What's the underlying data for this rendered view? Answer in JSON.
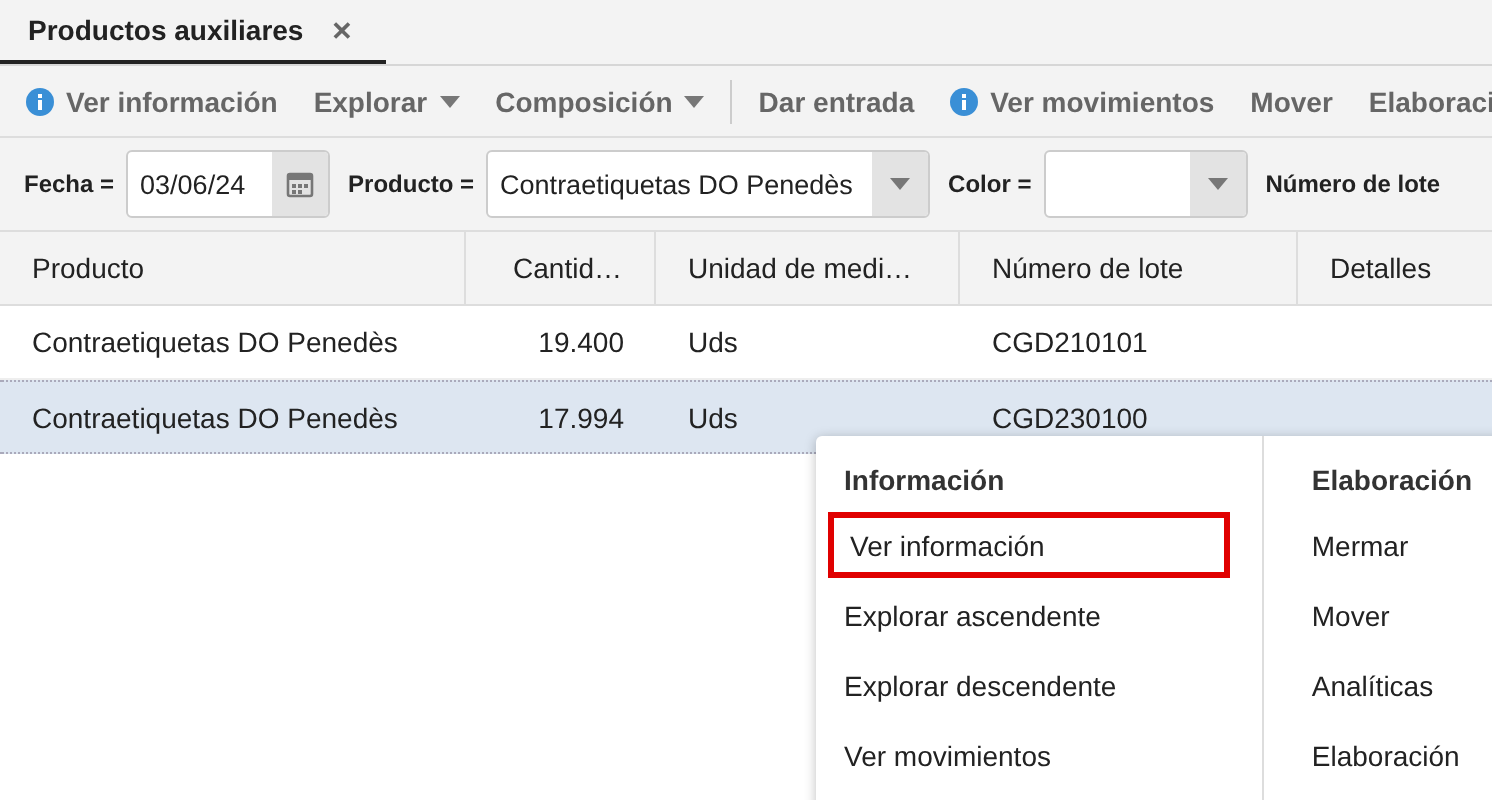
{
  "tabs": [
    {
      "label": "Productos auxiliares",
      "selected": true,
      "close": "✕"
    }
  ],
  "toolbar": [
    {
      "kind": "info",
      "label": "Ver información"
    },
    {
      "kind": "dropdown",
      "label": "Explorar"
    },
    {
      "kind": "dropdown",
      "label": "Composición"
    },
    {
      "kind": "separator"
    },
    {
      "kind": "plain",
      "label": "Dar entrada"
    },
    {
      "kind": "info",
      "label": "Ver movimientos"
    },
    {
      "kind": "plain",
      "label": "Mover"
    },
    {
      "kind": "plain",
      "label": "Elaboraci"
    }
  ],
  "filters": [
    {
      "kind": "date",
      "label": "Fecha =",
      "value": "03/06/24"
    },
    {
      "kind": "select",
      "label": "Producto =",
      "value": "Contraetiquetas DO Penedès"
    },
    {
      "kind": "select",
      "label": "Color ="
    },
    {
      "kind": "label",
      "label": "Número de lote"
    }
  ],
  "table": {
    "columns": [
      {
        "label": "Producto"
      },
      {
        "label": "Cantid…"
      },
      {
        "label": "Unidad de medi…"
      },
      {
        "label": "Número de lote"
      },
      {
        "label": "Detalles"
      }
    ],
    "rows": [
      {
        "selected": false,
        "cells": [
          "Contraetiquetas DO Penedès",
          "19.400",
          "Uds",
          "CGD210101",
          ""
        ]
      },
      {
        "selected": true,
        "cells": [
          "Contraetiquetas DO Penedès",
          "17.994",
          "Uds",
          "CGD230100",
          ""
        ]
      }
    ]
  },
  "context_menu": {
    "sections": [
      {
        "title": "Información",
        "items": [
          {
            "label": "Ver información",
            "highlighted": true
          },
          {
            "label": "Explorar ascendente",
            "highlighted": false
          },
          {
            "label": "Explorar descendente",
            "highlighted": false
          },
          {
            "label": "Ver movimientos",
            "highlighted": false
          }
        ]
      },
      {
        "title": "Elaboración",
        "items": [
          {
            "label": "Mermar",
            "highlighted": false
          },
          {
            "label": "Mover",
            "highlighted": false
          },
          {
            "label": "Analíticas",
            "highlighted": false
          },
          {
            "label": "Elaboración",
            "highlighted": false
          }
        ]
      }
    ]
  }
}
